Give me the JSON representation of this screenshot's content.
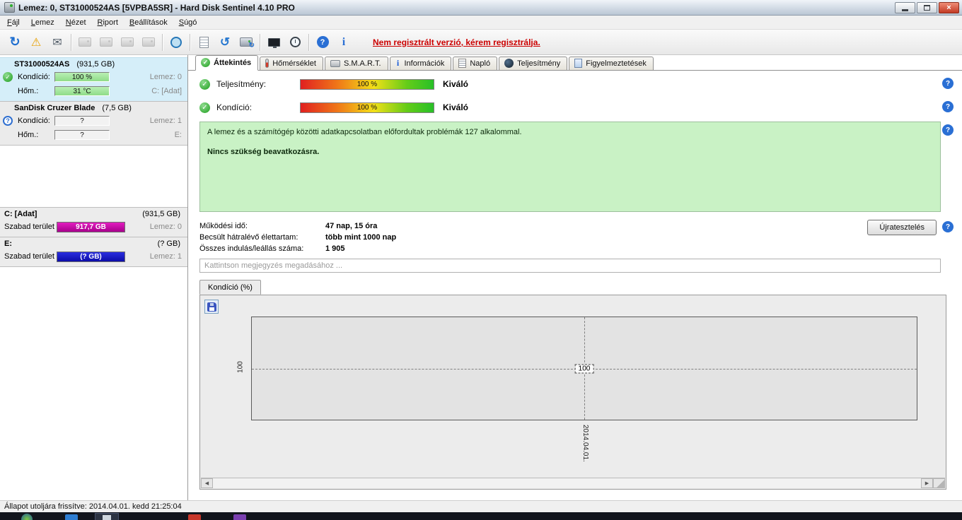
{
  "window": {
    "title": "Lemez: 0, ST31000524AS [5VPBA5SR]  -  Hard Disk Sentinel 4.10 PRO"
  },
  "menu": {
    "items": [
      {
        "label": "Fájl"
      },
      {
        "label": "Lemez"
      },
      {
        "label": "Nézet"
      },
      {
        "label": "Riport"
      },
      {
        "label": "Beállítások"
      },
      {
        "label": "Súgó"
      }
    ]
  },
  "toolbar": {
    "register_notice": "Nem regisztrált verzió, kérem regisztrálja."
  },
  "sidebar": {
    "disks": [
      {
        "name": "ST31000524AS",
        "size": "(931,5 GB)",
        "condition_label": "Kondíció:",
        "condition_value": "100 %",
        "right1": "Lemez: 0",
        "temp_label": "Hőm.:",
        "temp_value": "31 °C",
        "right2": "C: [Adat]"
      },
      {
        "name": "SanDisk Cruzer Blade",
        "size": "(7,5 GB)",
        "condition_label": "Kondíció:",
        "condition_value": "?",
        "right1": "Lemez: 1",
        "temp_label": "Hőm.:",
        "temp_value": "?",
        "right2": "E:"
      }
    ],
    "partitions": [
      {
        "name": "C: [Adat]",
        "size": "(931,5 GB)",
        "free_label": "Szabad terület",
        "free_value": "917,7 GB",
        "right": "Lemez: 0"
      },
      {
        "name": "E:",
        "size": "(? GB)",
        "free_label": "Szabad terület",
        "free_value": "(? GB)",
        "right": "Lemez: 1"
      }
    ]
  },
  "tabs": [
    {
      "label": "Áttekintés"
    },
    {
      "label": "Hőmérséklet"
    },
    {
      "label": "S.M.A.R.T."
    },
    {
      "label": "Információk"
    },
    {
      "label": "Napló"
    },
    {
      "label": "Teljesítmény"
    },
    {
      "label": "Figyelmeztetések"
    }
  ],
  "overview": {
    "performance_label": "Teljesítmény:",
    "performance_value": "100 %",
    "performance_rating": "Kiváló",
    "condition_label": "Kondíció:",
    "condition_value": "100 %",
    "condition_rating": "Kiváló",
    "message_line1": "A lemez és a számítógép közötti adatkapcsolatban előfordultak problémák 127 alkalommal.",
    "message_line2": "Nincs szükség beavatkozásra.",
    "stat1_label": "Működési idő:",
    "stat1_value": "47 nap, 15 óra",
    "stat2_label": "Becsült hátralévő élettartam:",
    "stat2_value": "több mint 1000 nap",
    "stat3_label": "Összes indulás/leállás száma:",
    "stat3_value": "1 905",
    "retest_button": "Újratesztelés",
    "comment_placeholder": "Kattintson megjegyzés megadásához ..."
  },
  "chart": {
    "tab_label": "Kondíció  (%)",
    "y_tick": "100",
    "point_label": "100",
    "x_tick": "2014.04.01.",
    "chart_data": {
      "type": "line",
      "title": "Kondíció (%)",
      "x": [
        "2014.04.01."
      ],
      "values": [
        100
      ],
      "ylim": [
        0,
        100
      ]
    }
  },
  "statusbar": {
    "text": "Állapot utoljára frissítve: 2014.04.01. kedd 21:25:04"
  },
  "glyphs": {
    "check": "✓",
    "question": "?",
    "help": "?",
    "info": "i",
    "close": "×",
    "warning": "⚠",
    "mail": "✉",
    "refresh": "↻",
    "sync": "↺",
    "left_arrow": "◀",
    "right_arrow": "▶"
  }
}
